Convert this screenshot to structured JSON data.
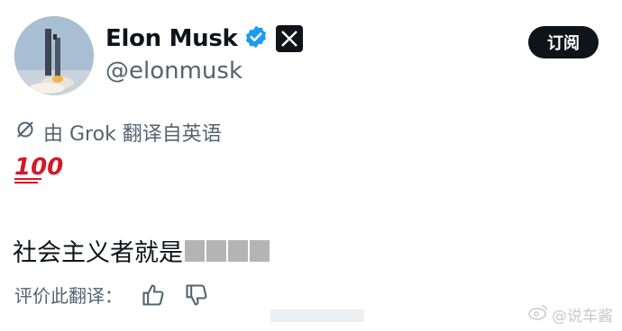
{
  "profile": {
    "name": "Elon Musk",
    "handle": "@elonmusk",
    "subscribe_label": "订阅"
  },
  "translation": {
    "label": "由 Grok 翻译自英语"
  },
  "post": {
    "emoji_text": "100",
    "text": "社会主义者就是"
  },
  "rating": {
    "label": "评价此翻译："
  },
  "watermark": {
    "text": "@说车酱"
  },
  "colors": {
    "verified": "#1d9bf0",
    "text_primary": "#0f1419",
    "text_secondary": "#536471",
    "hundred_emoji": "#d6172a"
  }
}
